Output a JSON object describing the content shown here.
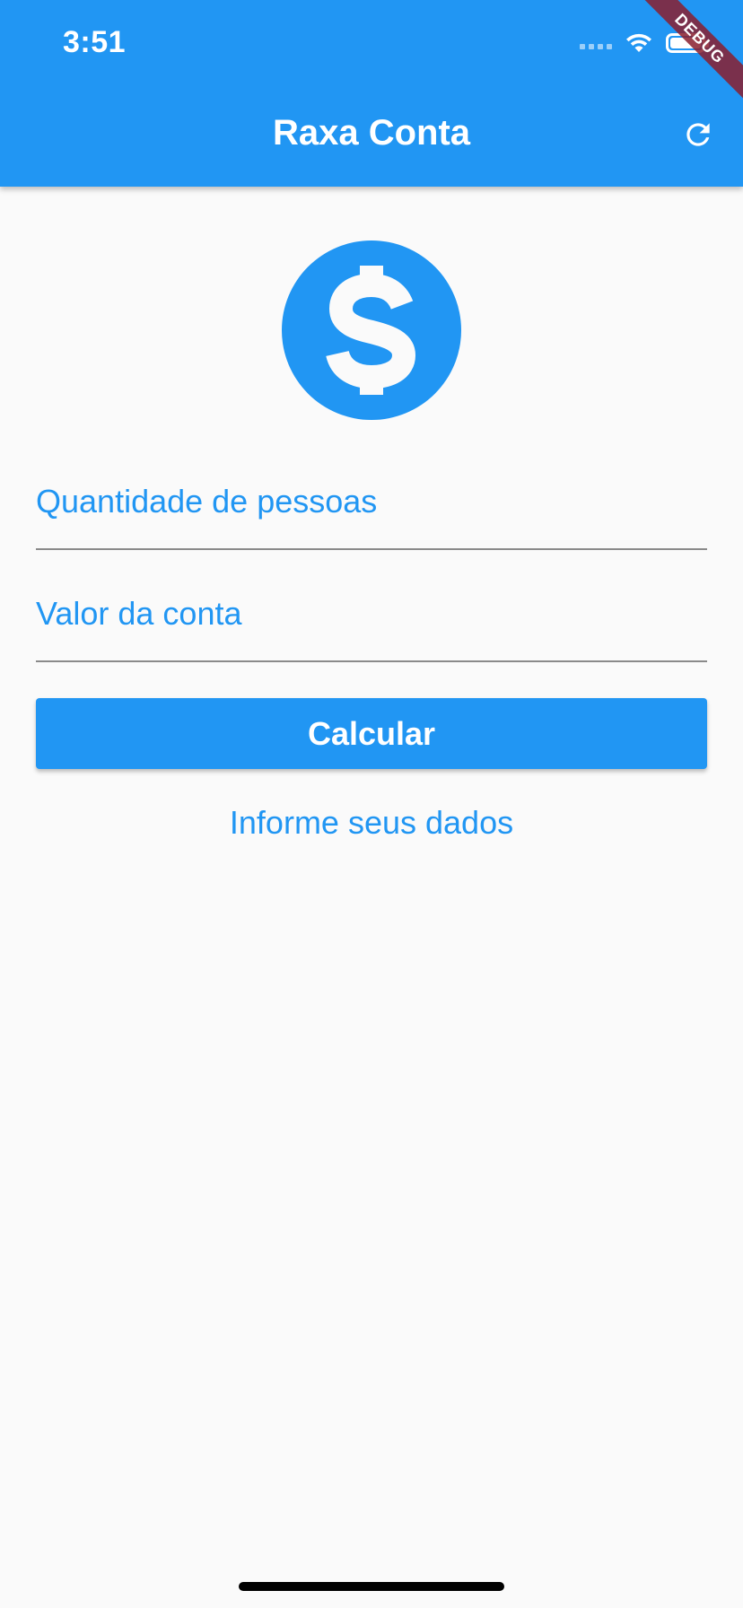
{
  "status_bar": {
    "time": "3:51"
  },
  "app_bar": {
    "title": "Raxa Conta",
    "refresh_icon": "refresh-icon"
  },
  "debug_banner": {
    "label": "DEBUG"
  },
  "main": {
    "hero_icon": "monetization-on-icon",
    "fields": [
      {
        "placeholder": "Quantidade de pessoas",
        "value": ""
      },
      {
        "placeholder": "Valor da conta",
        "value": ""
      }
    ],
    "calculate_label": "Calcular",
    "info_text": "Informe seus dados"
  },
  "colors": {
    "primary": "#2196f3",
    "background": "#fafafa",
    "divider": "#8a8a8a"
  }
}
